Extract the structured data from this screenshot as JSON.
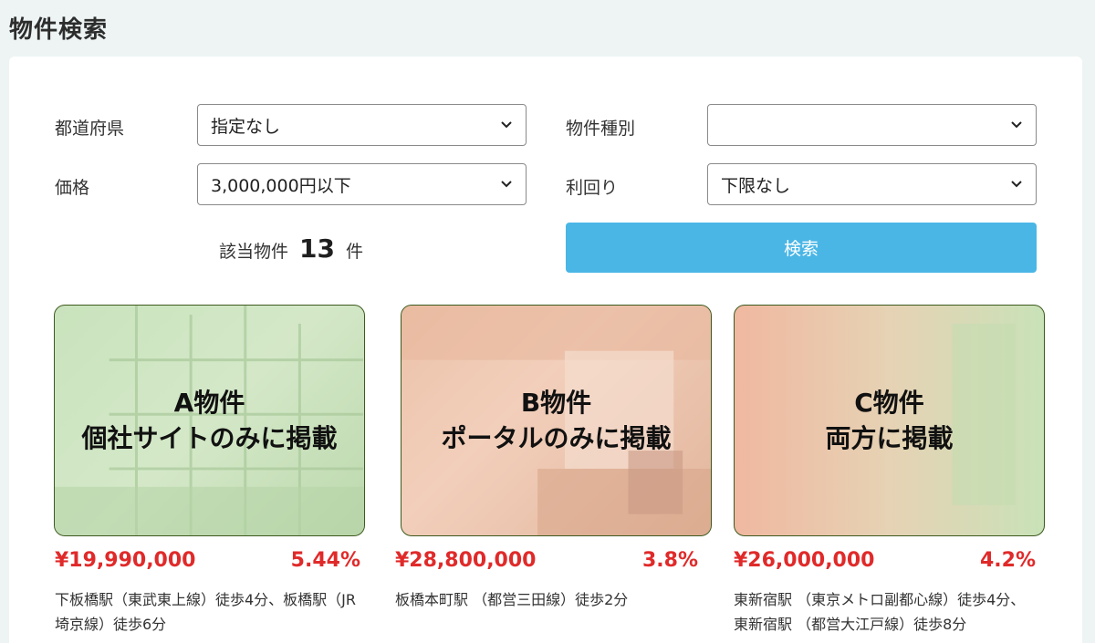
{
  "page": {
    "title": "物件検索"
  },
  "filters": {
    "prefecture": {
      "label": "都道府県",
      "value": "指定なし"
    },
    "property_type": {
      "label": "物件種別",
      "value": ""
    },
    "price": {
      "label": "価格",
      "value": "3,000,000円以下"
    },
    "yield": {
      "label": "利回り",
      "value": "下限なし"
    }
  },
  "results": {
    "prefix": "該当物件",
    "count": "13",
    "suffix": "件"
  },
  "search_button": {
    "label": "検索"
  },
  "listings": [
    {
      "title": "A物件",
      "subtitle": "個社サイトのみに掲載",
      "price": "¥19,990,000",
      "yield": "5.44%",
      "access": "下板橋駅（東武東上線）徒歩4分、板橋駅（JR埼京線）徒歩6分"
    },
    {
      "title": "B物件",
      "subtitle": "ポータルのみに掲載",
      "price": "¥28,800,000",
      "yield": "3.8%",
      "access": "板橋本町駅 （都営三田線）徒歩2分"
    },
    {
      "title": "C物件",
      "subtitle": "両方に掲載",
      "price": "¥26,000,000",
      "yield": "4.2%",
      "access": "東新宿駅 （東京メトロ副都心線）徒歩4分、東新宿駅 （都営大江戸線）徒歩8分"
    }
  ],
  "icons": {
    "select_arrow": "chevron-down-icon"
  },
  "colors": {
    "accent": "#4ab6e6",
    "price": "#e02a2a",
    "card_border": "#3d5a1e"
  }
}
